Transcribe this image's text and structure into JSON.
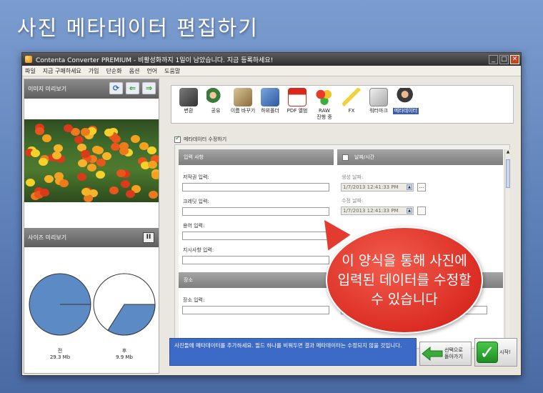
{
  "banner": {
    "title": "사진 메타데이터 편집하기"
  },
  "window": {
    "title": "Contenta Converter PREMIUM - 비활성화까지 1일이 남았습니다. 지금 등록하세요!"
  },
  "menu": [
    "파일",
    "지금 구매하세요",
    "가입",
    "단순화",
    "옵션",
    "언어",
    "도움말"
  ],
  "left": {
    "image_preview_label": "이미지 미리보기",
    "size_preview_label": "사이즈 미리보기",
    "before_label": "전",
    "before_size": "29.3 Mb",
    "after_label": "후",
    "after_size": "9.9 Mb",
    "after_fraction": 0.34
  },
  "toolbar": [
    {
      "label": "변환",
      "icon": "convert-icon"
    },
    {
      "label": "공유",
      "icon": "share-icon"
    },
    {
      "label": "이름 바꾸기",
      "icon": "rename-icon"
    },
    {
      "label": "하위폴더",
      "icon": "subfolder-icon"
    },
    {
      "label": "PDF 앨범",
      "icon": "pdf-icon"
    },
    {
      "label": "RAW\n진행 중",
      "icon": "raw-icon"
    },
    {
      "label": "FX",
      "icon": "fx-icon"
    },
    {
      "label": "워터마크",
      "icon": "watermark-icon"
    },
    {
      "label": "메타데이터",
      "icon": "metadata-icon",
      "active": true
    }
  ],
  "form": {
    "edit_metadata_label": "메타데이터 수정하기",
    "input_section": "입력 사항",
    "date_section": "날짜/시간",
    "copyright": "저작권 입력:",
    "credit": "크레딧 입력:",
    "keywords": "용어 입력:",
    "instructions": "지시사항 입력:",
    "created_date_label": "생성 날짜:",
    "created_date": "1/7/2013 12:41:33 PM",
    "modified_date_label": "수정 날짜:",
    "modified_date": "1/7/2013 12:41:33 PM",
    "ellipsis": "...",
    "location_section": "장소",
    "location": "장소 입력:"
  },
  "info": {
    "text": "사진들에 메타데이터를 추가하세요. 필드 하나를 비워두면 결과 메타데이터는 수정되지 않을 것입니다."
  },
  "buttons": {
    "back": "선택으로\n돌아가기",
    "start": "시작!"
  },
  "callout": {
    "text": "이 양식을 통해 사진에 입력된 데이터를 수정할 수 있습니다"
  }
}
